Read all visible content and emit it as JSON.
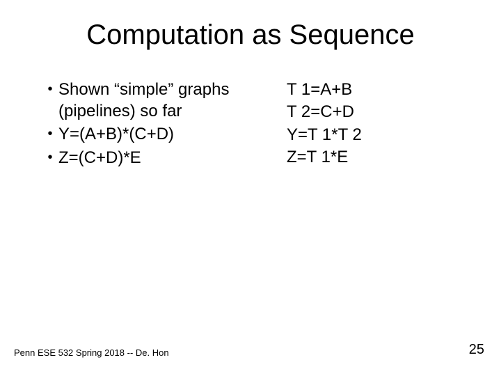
{
  "title": "Computation as Sequence",
  "bullets": {
    "b0": "Shown “simple” graphs (pipelines) so far",
    "b1": "Y=(A+B)*(C+D)",
    "b2": "Z=(C+D)*E"
  },
  "equations": {
    "e0": "T 1=A+B",
    "e1": "T 2=C+D",
    "e2": "Y=T 1*T 2",
    "e3": "Z=T 1*E"
  },
  "footer": {
    "left": "Penn ESE 532 Spring 2018 -- De. Hon",
    "right": "25"
  },
  "bullet_glyph": "•"
}
